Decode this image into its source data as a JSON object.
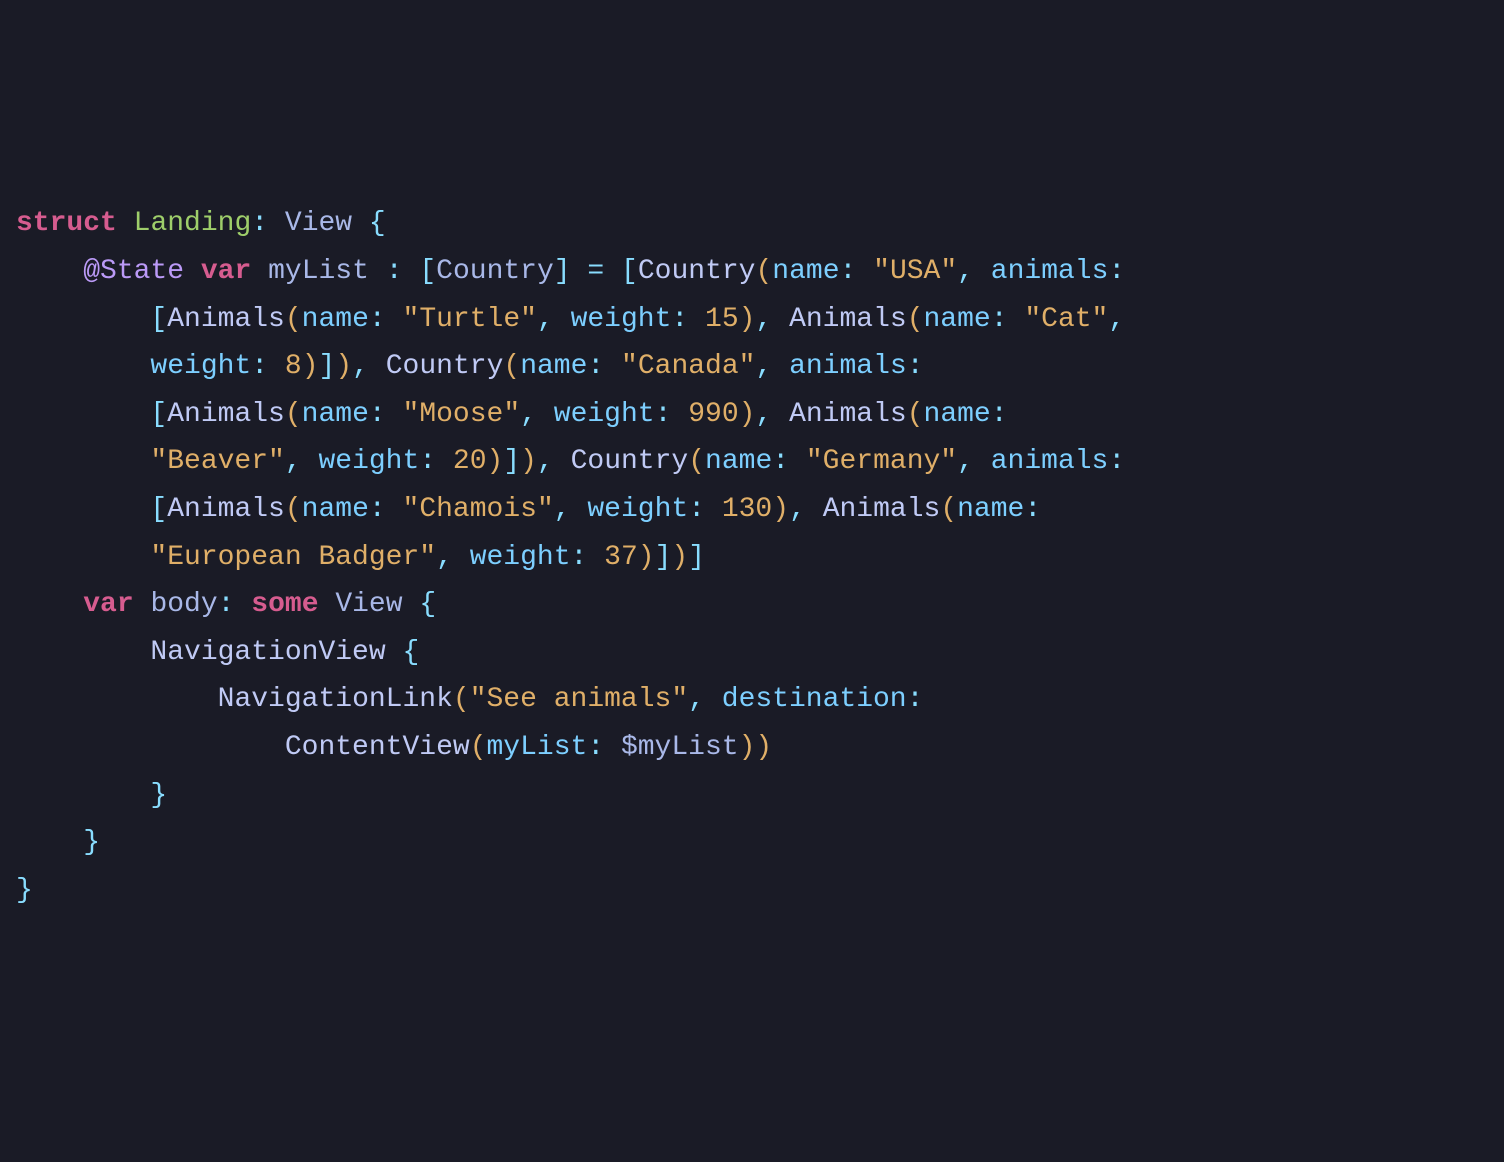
{
  "code": {
    "struct_kw": "struct",
    "struct_name": "Landing",
    "colon1": ":",
    "view_type": "View",
    "lbrace1": "{",
    "state_attr": "@State",
    "var_kw1": "var",
    "mylist_name": "myList",
    "colon2": ":",
    "lbracket1": "[",
    "country_type": "Country",
    "rbracket1": "]",
    "eq": "=",
    "lbracket2": "[",
    "country_call1": "Country",
    "lparen1": "(",
    "name_param1": "name",
    "colon3": ":",
    "usa_str": "\"USA\"",
    "comma1": ",",
    "animals_param1": "animals",
    "colon4": ":",
    "lbracket3": "[",
    "animals_call1": "Animals",
    "lparen2": "(",
    "name_param2": "name",
    "colon5": ":",
    "turtle_str": "\"Turtle\"",
    "comma2": ",",
    "weight_param1": "weight",
    "colon6": ":",
    "num15": "15",
    "rparen1": ")",
    "comma3": ",",
    "animals_call2": "Animals",
    "lparen3": "(",
    "name_param3": "name",
    "colon7": ":",
    "cat_str": "\"Cat\"",
    "comma4": ",",
    "weight_param2": "weight",
    "colon8": ":",
    "num8": "8",
    "rparen2": ")",
    "rbracket4": "]",
    "rparen3": ")",
    "comma5": ",",
    "country_call2": "Country",
    "lparen4": "(",
    "name_param4": "name",
    "colon9": ":",
    "canada_str": "\"Canada\"",
    "comma6": ",",
    "animals_param2": "animals",
    "colon10": ":",
    "lbracket5": "[",
    "animals_call3": "Animals",
    "lparen5": "(",
    "name_param5": "name",
    "colon11": ":",
    "moose_str": "\"Moose\"",
    "comma7": ",",
    "weight_param3": "weight",
    "colon12": ":",
    "num990": "990",
    "rparen4": ")",
    "comma8": ",",
    "animals_call4": "Animals",
    "lparen6": "(",
    "name_param6": "name",
    "colon13": ":",
    "beaver_str": "\"Beaver\"",
    "comma9": ",",
    "weight_param4": "weight",
    "colon14": ":",
    "num20": "20",
    "rparen5": ")",
    "rbracket6": "]",
    "rparen6": ")",
    "comma10": ",",
    "country_call3": "Country",
    "lparen7": "(",
    "name_param7": "name",
    "colon15": ":",
    "germany_str": "\"Germany\"",
    "comma11": ",",
    "animals_param3": "animals",
    "colon16": ":",
    "lbracket7": "[",
    "animals_call5": "Animals",
    "lparen8": "(",
    "name_param8": "name",
    "colon17": ":",
    "chamois_str": "\"Chamois\"",
    "comma12": ",",
    "weight_param5": "weight",
    "colon18": ":",
    "num130": "130",
    "rparen7": ")",
    "comma13": ",",
    "animals_call6": "Animals",
    "lparen9": "(",
    "name_param9": "name",
    "colon19": ":",
    "badger_str": "\"European Badger\"",
    "comma14": ",",
    "weight_param6": "weight",
    "colon20": ":",
    "num37": "37",
    "rparen8": ")",
    "rbracket8": "]",
    "rparen9": ")",
    "rbracket9": "]",
    "var_kw2": "var",
    "body_name": "body",
    "colon21": ":",
    "some_kw": "some",
    "view_type2": "View",
    "lbrace2": "{",
    "navview": "NavigationView",
    "lbrace3": "{",
    "navlink": "NavigationLink",
    "lparen10": "(",
    "see_str": "\"See animals\"",
    "comma15": ",",
    "dest_param": "destination",
    "colon22": ":",
    "contentview": "ContentView",
    "lparen11": "(",
    "mylist_param": "myList",
    "colon23": ":",
    "dollar": "$myList",
    "rparen10": ")",
    "rparen11": ")",
    "rbrace3": "}",
    "rbrace2": "}",
    "rbrace1": "}"
  }
}
